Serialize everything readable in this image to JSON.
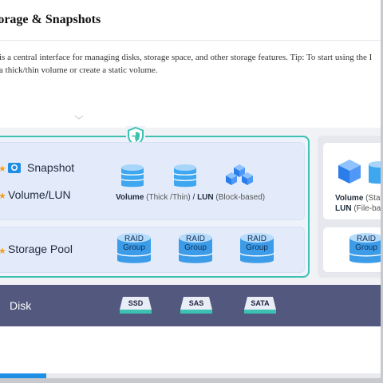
{
  "window": {
    "title": "torage & Snapshots",
    "description_lines": [
      "is a central interface for managing disks, storage space, and other storage features. Tip: To start using the I",
      "a thick/thin volume or create a static volume."
    ]
  },
  "diagram": {
    "snapshot_label": "Snapshot",
    "volume_lun_label": "Volume/LUN",
    "storage_pool_label": "Storage Pool",
    "volume_caption": {
      "volume": "Volume",
      "volume_types": " (Thick /Thin)",
      "sep": " / ",
      "lun": "LUN",
      "lun_type": " (Block-based)"
    },
    "raid_group_label": "RAID\nGroup",
    "right_panel": {
      "volume_bold": "Volume",
      "volume_rest": " (Stati",
      "lun_bold": "LUN",
      "lun_rest": " (File-bas",
      "raid_group_label": "RAID\nGroup"
    },
    "disk_label": "Disk",
    "disk_types": [
      "SSD",
      "SAS",
      "SATA"
    ]
  },
  "scrollbar": {
    "position_fraction": 0.12
  },
  "colors": {
    "accent": "#1f8fe6",
    "teal_frame": "#3cc1b3",
    "disk_bar": "#53587f",
    "star": "#f2a11c"
  },
  "icons": [
    "shield-icon",
    "camera-icon",
    "star-icon",
    "cylinder-icon",
    "cube-icon",
    "disk-chip-icon"
  ]
}
